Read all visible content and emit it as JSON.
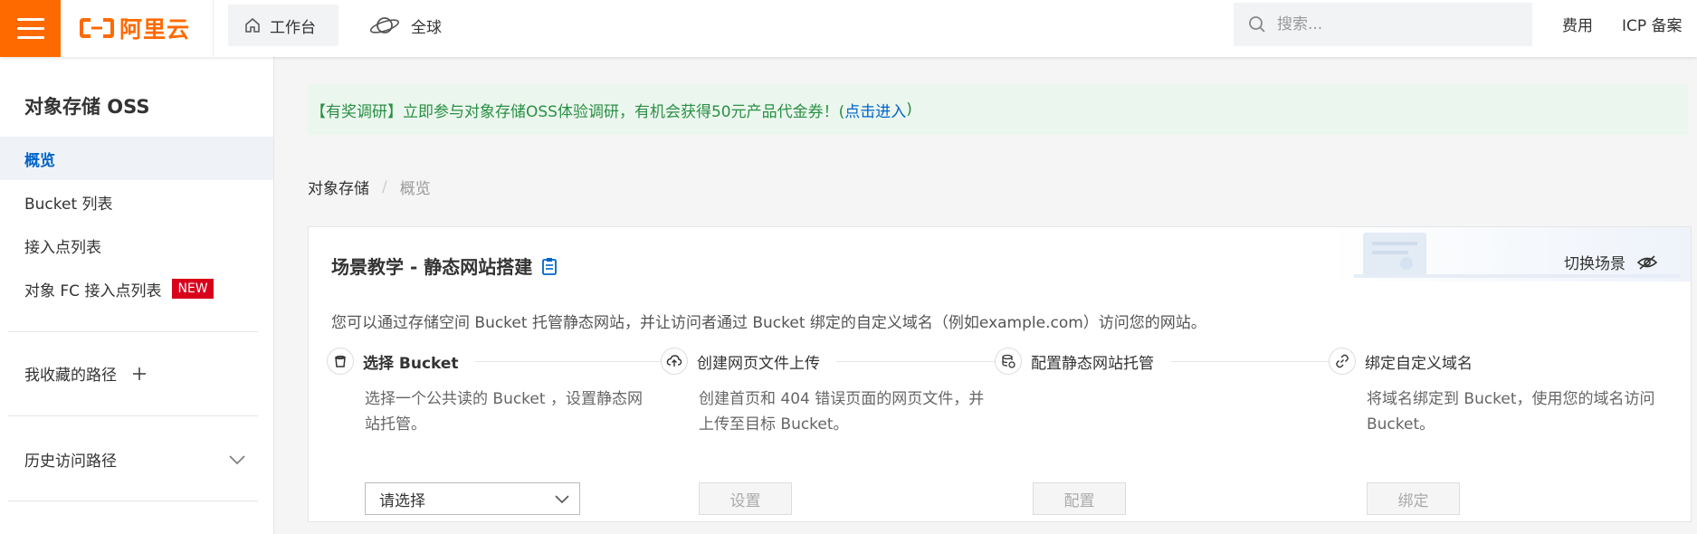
{
  "topbar": {
    "logo_text": "阿里云",
    "workbench_label": "工作台",
    "region_label": "全球",
    "search_placeholder": "搜索...",
    "links": [
      "费用",
      "ICP 备案"
    ],
    "brand_color": "#ff6a00"
  },
  "sidebar": {
    "title": "对象存储 OSS",
    "items": [
      {
        "label": "概览",
        "active": true
      },
      {
        "label": "Bucket 列表"
      },
      {
        "label": "接入点列表"
      },
      {
        "label": "对象 FC 接入点列表",
        "badge": "NEW"
      }
    ],
    "favorites_label": "我收藏的路径",
    "history_label": "历史访问路径"
  },
  "notice": {
    "text": "【有奖调研】立即参与对象存储OSS体验调研，有机会获得50元产品代金券！(",
    "link": "点击进入",
    "suffix": ")"
  },
  "breadcrumb": {
    "root": "对象存储",
    "separator": "/",
    "current": "概览"
  },
  "card": {
    "title": "场景教学 - 静态网站搭建",
    "switch_label": "切换场景",
    "description": "您可以通过存储空间 Bucket 托管静态网站，并让访问者通过 Bucket 绑定的自定义域名（例如example.com）访问您的网站。",
    "steps": [
      {
        "icon": "bucket-icon",
        "title": "选择 Bucket",
        "desc": "选择一个公共读的 Bucket ，设置静态网站托管。",
        "control": "请选择"
      },
      {
        "icon": "cloud-upload-icon",
        "title": "创建网页文件上传",
        "desc": "创建首页和 404 错误页面的网页文件，并上传至目标 Bucket。",
        "control": "设置"
      },
      {
        "icon": "database-icon",
        "title": "配置静态网站托管",
        "desc": "",
        "control": "配置"
      },
      {
        "icon": "link-icon",
        "title": "绑定自定义域名",
        "desc": "将域名绑定到 Bucket，使用您的域名访问 Bucket。",
        "control": "绑定"
      }
    ]
  }
}
